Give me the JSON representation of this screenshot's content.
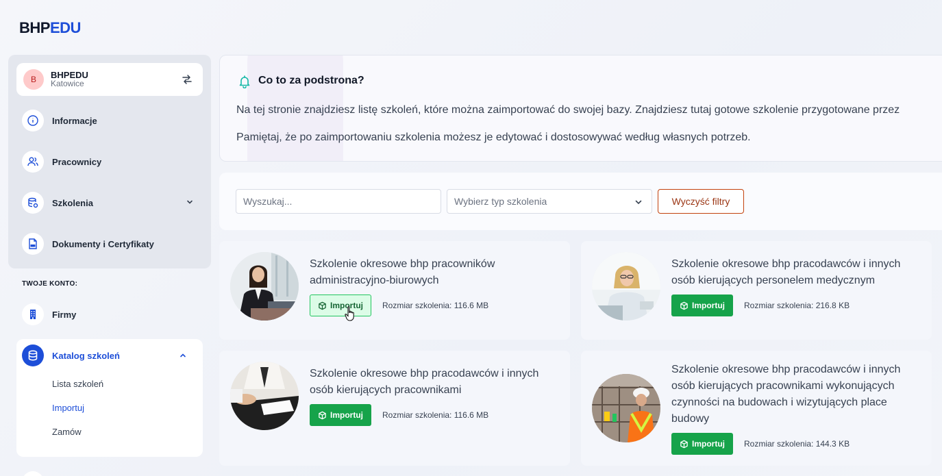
{
  "logo": {
    "part1": "BHP",
    "part2": "EDU"
  },
  "company": {
    "avatar_letter": "B",
    "name": "BHPEDU",
    "city": "Katowice"
  },
  "nav": {
    "items": [
      {
        "label": "Informacje"
      },
      {
        "label": "Pracownicy"
      },
      {
        "label": "Szkolenia"
      },
      {
        "label": "Dokumenty i Certyfikaty"
      }
    ],
    "account_section": "TWOJE KONTO:",
    "firmy": "Firmy",
    "catalog": {
      "label": "Katalog szkoleń",
      "sub": [
        "Lista szkoleń",
        "Importuj",
        "Zamów"
      ]
    }
  },
  "info": {
    "title": "Co to za podstrona?",
    "line1": "Na tej stronie znajdziesz listę szkoleń, które można zaimportować do swojej bazy. Znajdziesz tutaj gotowe szkolenie przygotowane przez",
    "line2": "Pamiętaj, że po zaimportowaniu szkolenia możesz je edytować i dostosowywać według własnych potrzeb."
  },
  "filters": {
    "search_placeholder": "Wyszukaj...",
    "type_placeholder": "Wybierz typ szkolenia",
    "clear_label": "Wyczyść filtry"
  },
  "courses": [
    {
      "title": "Szkolenie okresowe bhp pracowników administracyjno-biurowych",
      "import_label": "Importuj",
      "size": "Rozmiar szkolenia: 116.6 MB"
    },
    {
      "title": "Szkolenie okresowe bhp pracodawców i innych osób kierujących personelem medycznym",
      "import_label": "Importuj",
      "size": "Rozmiar szkolenia: 216.8 KB"
    },
    {
      "title": "Szkolenie okresowe bhp pracodawców i innych osób kierujących pracownikami",
      "import_label": "Importuj",
      "size": "Rozmiar szkolenia: 116.6 MB"
    },
    {
      "title": "Szkolenie okresowe bhp pracodawców i innych osób kierujących pracownikami wykonujących czynności na budowach i wizytujących place budowy",
      "import_label": "Importuj",
      "size": "Rozmiar szkolenia: 144.3 KB"
    }
  ],
  "colors": {
    "accent": "#1d4ed8",
    "import_green": "#16a34a",
    "clear_orange": "#c2410c"
  }
}
